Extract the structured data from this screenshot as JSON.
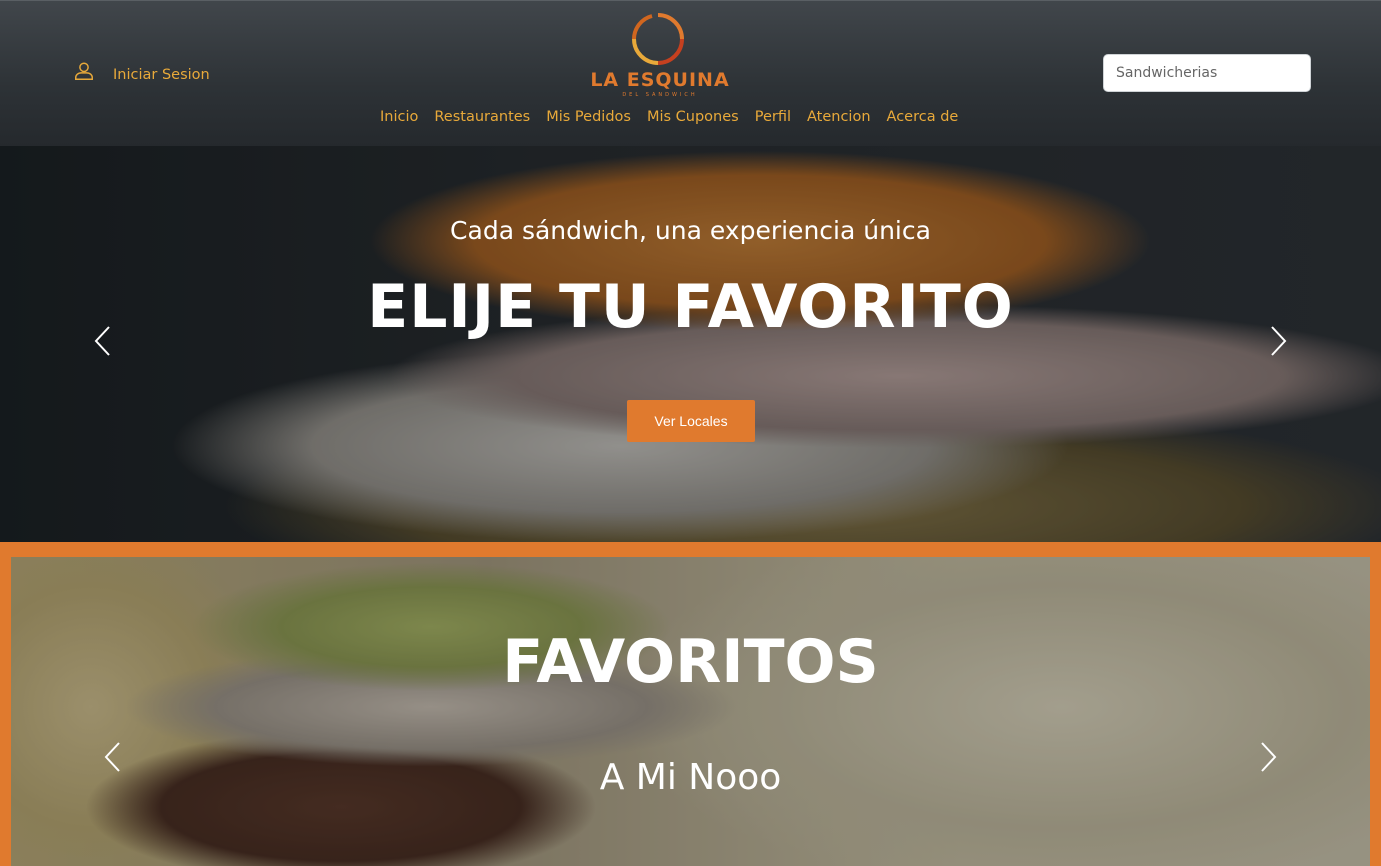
{
  "header": {
    "login_label": "Iniciar Sesion",
    "logo_name": "LA ESQUINA",
    "logo_tagline": "DEL SANDWICH",
    "search_placeholder": "Sandwicherias",
    "nav": [
      "Inicio",
      "Restaurantes",
      "Mis Pedidos",
      "Mis Cupones",
      "Perfil",
      "Atencion",
      "Acerca de"
    ]
  },
  "hero": {
    "subtitle": "Cada sándwich, una experiencia única",
    "title": "ELIJE TU FAVORITO",
    "button_label": "Ver Locales"
  },
  "favorites": {
    "title": "FAVORITOS",
    "subtitle": "A Mi Nooo"
  },
  "colors": {
    "accent": "#e07a2e",
    "nav_text": "#e8a93a",
    "header_bg": "#2d3236"
  },
  "icons": [
    "user-icon",
    "chevron-left-icon",
    "chevron-right-icon"
  ]
}
